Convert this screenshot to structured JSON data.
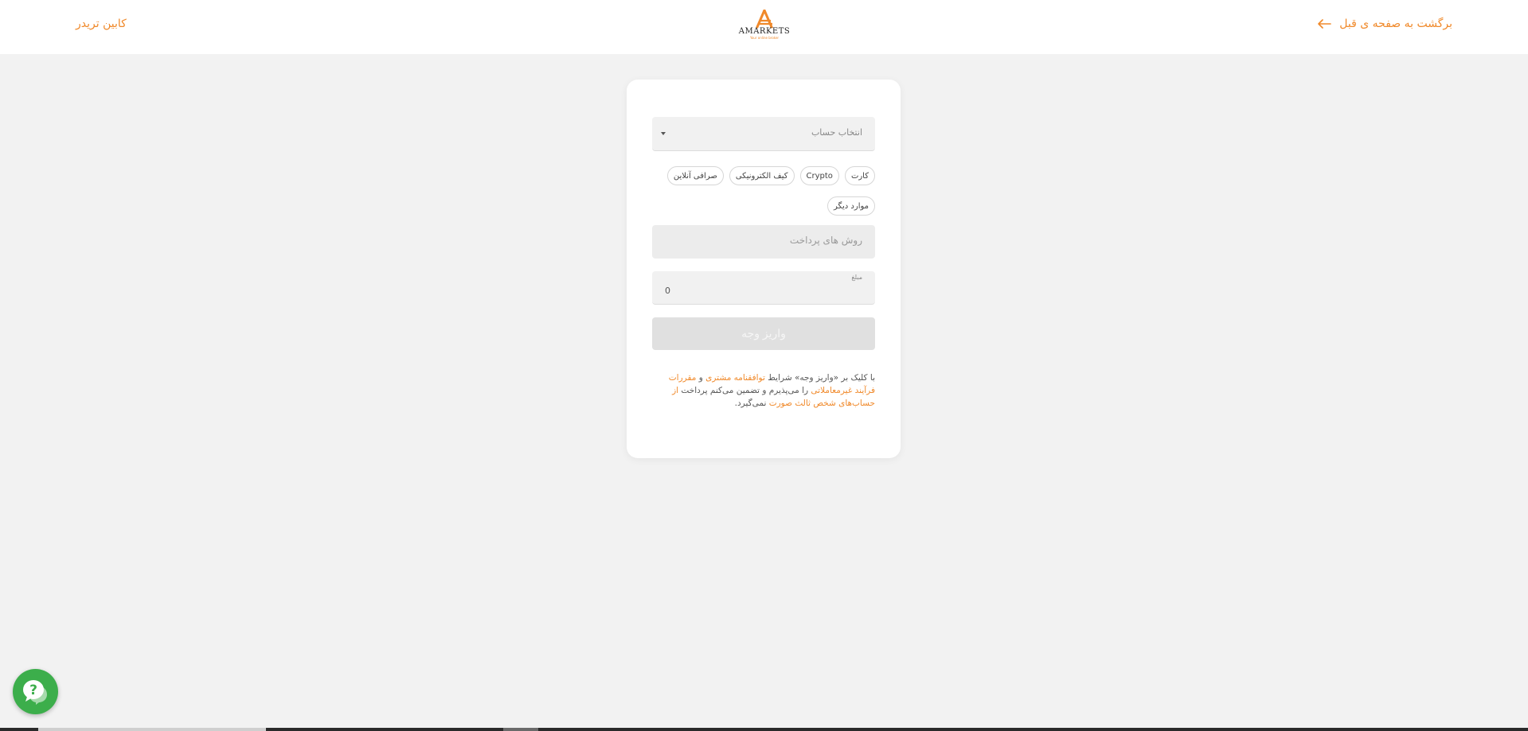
{
  "header": {
    "back_label": "برگشت به صفحه ی قبل",
    "back_icon": "arrow-left-icon",
    "logo_text": "AMARKETS",
    "logo_tagline": "Your online broker",
    "trader_cabinet_label": "کابین تریدر"
  },
  "form": {
    "account_select_label": "انتخاب حساب",
    "method_chips": [
      "کارت",
      "Crypto",
      "کیف الکترونیکی",
      "صرافی آنلاین",
      "موارد دیگر"
    ],
    "payment_methods_placeholder": "روش های پرداخت",
    "amount_label": "مبلغ",
    "amount_value": "0",
    "submit_label": "واریز وجه"
  },
  "terms": {
    "part1": "با کلیک بر «واریز وجه» شرایط ",
    "link1": "توافقنامه مشتری",
    "part2": " و ",
    "link2": "مقررات فرآیند غیرمعاملاتی",
    "part3": " را می‌پذیرم و تضمین می‌کنم پرداخت ",
    "link3": "از حساب‌های شخص ثالث صورت",
    "part4": " نمی‌گیرد."
  },
  "support": {
    "help_icon": "chat-help-icon"
  },
  "colors": {
    "accent": "#f0892a",
    "background": "#f2f2f2",
    "help_button": "#3cae4b"
  }
}
